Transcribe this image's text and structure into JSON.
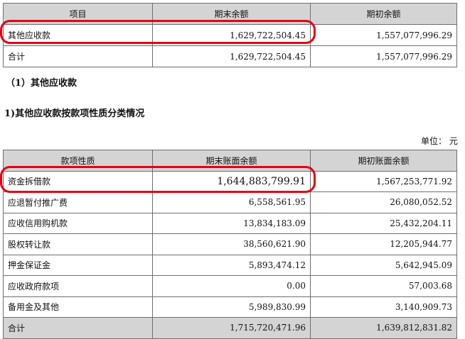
{
  "table1": {
    "headers": [
      "项目",
      "期末余额",
      "期初余额"
    ],
    "rows": [
      {
        "label": "其他应收款",
        "end": "1,629,722,504.45",
        "begin": "1,557,077,996.29"
      },
      {
        "label": "合计",
        "end": "1,629,722,504.45",
        "begin": "1,557,077,996.29"
      }
    ]
  },
  "section_title": "（1）其他应收款",
  "subsection_title": "1)其他应收款按款项性质分类情况",
  "unit": "单位：  元",
  "table2": {
    "headers": [
      "款项性质",
      "期末账面余额",
      "期初账面余额"
    ],
    "rows": [
      {
        "label": "资金拆借款",
        "end": "1,644,883,799.91",
        "begin": "1,567,253,771.92"
      },
      {
        "label": "应退暂付推广费",
        "end": "6,558,561.95",
        "begin": "26,080,052.52"
      },
      {
        "label": "应收信用购机款",
        "end": "13,834,183.09",
        "begin": "25,432,204.11"
      },
      {
        "label": "股权转让款",
        "end": "38,560,621.90",
        "begin": "12,205,944.77"
      },
      {
        "label": "押金保证金",
        "end": "5,893,474.12",
        "begin": "5,642,945.09"
      },
      {
        "label": "应收政府款项",
        "end": "0.00",
        "begin": "57,003.68"
      },
      {
        "label": "备用金及其他",
        "end": "5,989,830.99",
        "begin": "3,140,909.73"
      },
      {
        "label": "合计",
        "end": "1,715,720,471.96",
        "begin": "1,639,812,831.82"
      }
    ]
  }
}
